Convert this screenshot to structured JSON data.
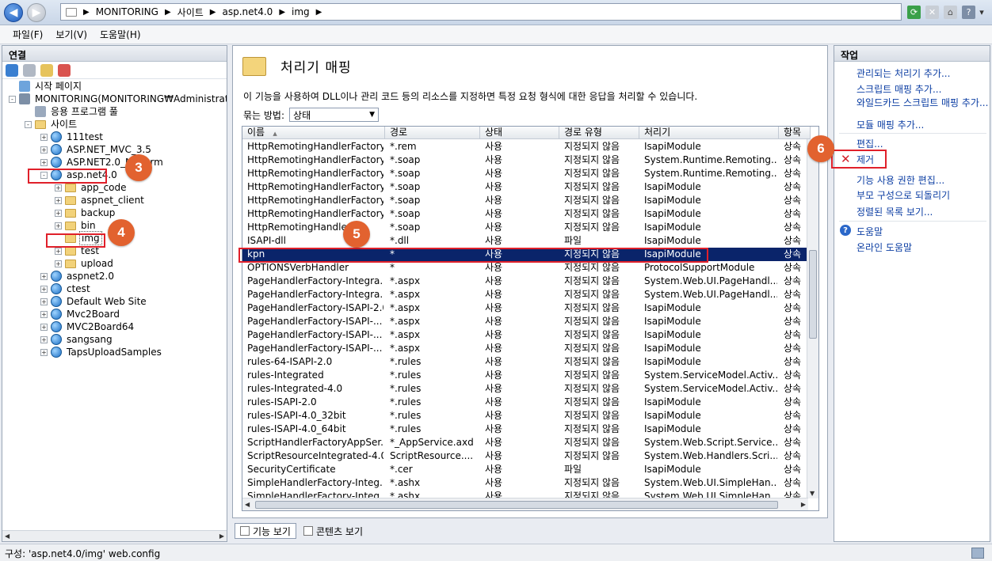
{
  "address": {
    "crumbs": [
      "MONITORING",
      "사이트",
      "asp.net4.0",
      "img"
    ]
  },
  "menu": [
    "파일(F)",
    "보기(V)",
    "도움말(H)"
  ],
  "connections": {
    "title": "연결",
    "tree": [
      {
        "label": "시작 페이지",
        "level": 1,
        "expander": "",
        "icon": "start-page-icon"
      },
      {
        "label": "MONITORING(MONITORING₩Administrato",
        "level": 1,
        "expander": "-",
        "icon": "server-icon"
      },
      {
        "label": "응용 프로그램 풀",
        "level": 2,
        "expander": "",
        "icon": "app-pool-icon"
      },
      {
        "label": "사이트",
        "level": 2,
        "expander": "-",
        "icon": "sites-folder-icon"
      },
      {
        "label": "111test",
        "level": 3,
        "expander": "+",
        "icon": "globe-icon"
      },
      {
        "label": "ASP.NET_MVC_3.5",
        "level": 3,
        "expander": "+",
        "icon": "globe-icon"
      },
      {
        "label": "ASP.NET2.0_Mem",
        "level": 3,
        "expander": "+",
        "icon": "globe-icon",
        "suffix": "rm"
      },
      {
        "label": "asp.net4.0",
        "level": 3,
        "expander": "-",
        "icon": "globe-icon"
      },
      {
        "label": "app_code",
        "level": 4,
        "expander": "+",
        "icon": "folder-icon"
      },
      {
        "label": "aspnet_client",
        "level": 4,
        "expander": "+",
        "icon": "folder-icon"
      },
      {
        "label": "backup",
        "level": 4,
        "expander": "+",
        "icon": "folder-icon"
      },
      {
        "label": "bin",
        "level": 4,
        "expander": "+",
        "icon": "folder-icon"
      },
      {
        "label": "img",
        "level": 4,
        "expander": "",
        "icon": "folder-icon"
      },
      {
        "label": "test",
        "level": 4,
        "expander": "+",
        "icon": "folder-icon"
      },
      {
        "label": "upload",
        "level": 4,
        "expander": "+",
        "icon": "folder-icon"
      },
      {
        "label": "aspnet2.0",
        "level": 3,
        "expander": "+",
        "icon": "globe-icon"
      },
      {
        "label": "ctest",
        "level": 3,
        "expander": "+",
        "icon": "globe-icon"
      },
      {
        "label": "Default Web Site",
        "level": 3,
        "expander": "+",
        "icon": "globe-icon"
      },
      {
        "label": "Mvc2Board",
        "level": 3,
        "expander": "+",
        "icon": "globe-icon"
      },
      {
        "label": "MVC2Board64",
        "level": 3,
        "expander": "+",
        "icon": "globe-icon"
      },
      {
        "label": "sangsang",
        "level": 3,
        "expander": "+",
        "icon": "globe-icon"
      },
      {
        "label": "TapsUploadSamples",
        "level": 3,
        "expander": "+",
        "icon": "globe-icon"
      }
    ]
  },
  "center": {
    "title": "처리기 매핑",
    "description": "이 기능을 사용하여 DLL이나 관리 코드 등의 리소스를 지정하면 특정 요청 형식에 대한 응답을 처리할 수 있습니다.",
    "group_by_label": "묶는 방법:",
    "group_by_value": "상태",
    "columns": [
      "이름",
      "경로",
      "상태",
      "경로 유형",
      "처리기",
      "항목"
    ],
    "rows": [
      [
        "HttpRemotingHandlerFactory...",
        "*.rem",
        "사용",
        "지정되지 않음",
        "IsapiModule",
        "상속"
      ],
      [
        "HttpRemotingHandlerFactory...",
        "*.soap",
        "사용",
        "지정되지 않음",
        "System.Runtime.Remoting....",
        "상속"
      ],
      [
        "HttpRemotingHandlerFactory...",
        "*.soap",
        "사용",
        "지정되지 않음",
        "System.Runtime.Remoting....",
        "상속"
      ],
      [
        "HttpRemotingHandlerFactory...",
        "*.soap",
        "사용",
        "지정되지 않음",
        "IsapiModule",
        "상속"
      ],
      [
        "HttpRemotingHandlerFactory...",
        "*.soap",
        "사용",
        "지정되지 않음",
        "IsapiModule",
        "상속"
      ],
      [
        "HttpRemotingHandlerFactory...",
        "*.soap",
        "사용",
        "지정되지 않음",
        "IsapiModule",
        "상속"
      ],
      [
        "HttpRemotingHandlerF...",
        "*.soap",
        "사용",
        "지정되지 않음",
        "IsapiModule",
        "상속"
      ],
      [
        "ISAPI-dll",
        "*.dll",
        "사용",
        "파일",
        "IsapiModule",
        "상속"
      ],
      [
        "kpn",
        "*",
        "사용",
        "지정되지 않음",
        "IsapiModule",
        "상속"
      ],
      [
        "OPTIONSVerbHandler",
        "*",
        "사용",
        "지정되지 않음",
        "ProtocolSupportModule",
        "상속"
      ],
      [
        "PageHandlerFactory-Integra...",
        "*.aspx",
        "사용",
        "지정되지 않음",
        "System.Web.UI.PageHandl...",
        "상속"
      ],
      [
        "PageHandlerFactory-Integra...",
        "*.aspx",
        "사용",
        "지정되지 않음",
        "System.Web.UI.PageHandl...",
        "상속"
      ],
      [
        "PageHandlerFactory-ISAPI-2.0",
        "*.aspx",
        "사용",
        "지정되지 않음",
        "IsapiModule",
        "상속"
      ],
      [
        "PageHandlerFactory-ISAPI-...",
        "*.aspx",
        "사용",
        "지정되지 않음",
        "IsapiModule",
        "상속"
      ],
      [
        "PageHandlerFactory-ISAPI-...",
        "*.aspx",
        "사용",
        "지정되지 않음",
        "IsapiModule",
        "상속"
      ],
      [
        "PageHandlerFactory-ISAPI-...",
        "*.aspx",
        "사용",
        "지정되지 않음",
        "IsapiModule",
        "상속"
      ],
      [
        "rules-64-ISAPI-2.0",
        "*.rules",
        "사용",
        "지정되지 않음",
        "IsapiModule",
        "상속"
      ],
      [
        "rules-Integrated",
        "*.rules",
        "사용",
        "지정되지 않음",
        "System.ServiceModel.Activ...",
        "상속"
      ],
      [
        "rules-Integrated-4.0",
        "*.rules",
        "사용",
        "지정되지 않음",
        "System.ServiceModel.Activ...",
        "상속"
      ],
      [
        "rules-ISAPI-2.0",
        "*.rules",
        "사용",
        "지정되지 않음",
        "IsapiModule",
        "상속"
      ],
      [
        "rules-ISAPI-4.0_32bit",
        "*.rules",
        "사용",
        "지정되지 않음",
        "IsapiModule",
        "상속"
      ],
      [
        "rules-ISAPI-4.0_64bit",
        "*.rules",
        "사용",
        "지정되지 않음",
        "IsapiModule",
        "상속"
      ],
      [
        "ScriptHandlerFactoryAppSer...",
        "*_AppService.axd",
        "사용",
        "지정되지 않음",
        "System.Web.Script.Service....",
        "상속"
      ],
      [
        "ScriptResourceIntegrated-4.0",
        "ScriptResource....",
        "사용",
        "지정되지 않음",
        "System.Web.Handlers.Scri...",
        "상속"
      ],
      [
        "SecurityCertificate",
        "*.cer",
        "사용",
        "파일",
        "IsapiModule",
        "상속"
      ],
      [
        "SimpleHandlerFactory-Integ...",
        "*.ashx",
        "사용",
        "지정되지 않음",
        "System.Web.UI.SimpleHan...",
        "상속"
      ],
      [
        "SimpleHandlerFactory-Integ...",
        "*.ashx",
        "사용",
        "지정되지 않음",
        "System.Web.UI.SimpleHan...",
        "상속"
      ]
    ],
    "selected_row": 8
  },
  "view_tabs": [
    "기능 보기",
    "콘텐츠 보기"
  ],
  "actions": {
    "title": "작업",
    "items": [
      {
        "label": "관리되는 처리기 추가..."
      },
      {
        "label": "스크립트 매핑 추가..."
      },
      {
        "label": "와일드카드 스크립트 매핑 추가..."
      },
      {
        "label": "모듈 매핑 추가..."
      },
      {
        "label": "편집..."
      },
      {
        "label": "제거"
      },
      {
        "label": "기능 사용 권한 편집..."
      },
      {
        "label": "부모 구성으로 되돌리기"
      },
      {
        "label": "정렬된 목록 보기..."
      },
      {
        "label": "도움말"
      },
      {
        "label": "온라인 도움말"
      }
    ]
  },
  "status": "구성: 'asp.net4.0/img' web.config",
  "badges": [
    "3",
    "4",
    "5",
    "6"
  ],
  "colors": {
    "accent": "#0a246a",
    "badge": "#e2622f",
    "highlight_box": "#e0202a",
    "link": "#0c3ea3"
  }
}
